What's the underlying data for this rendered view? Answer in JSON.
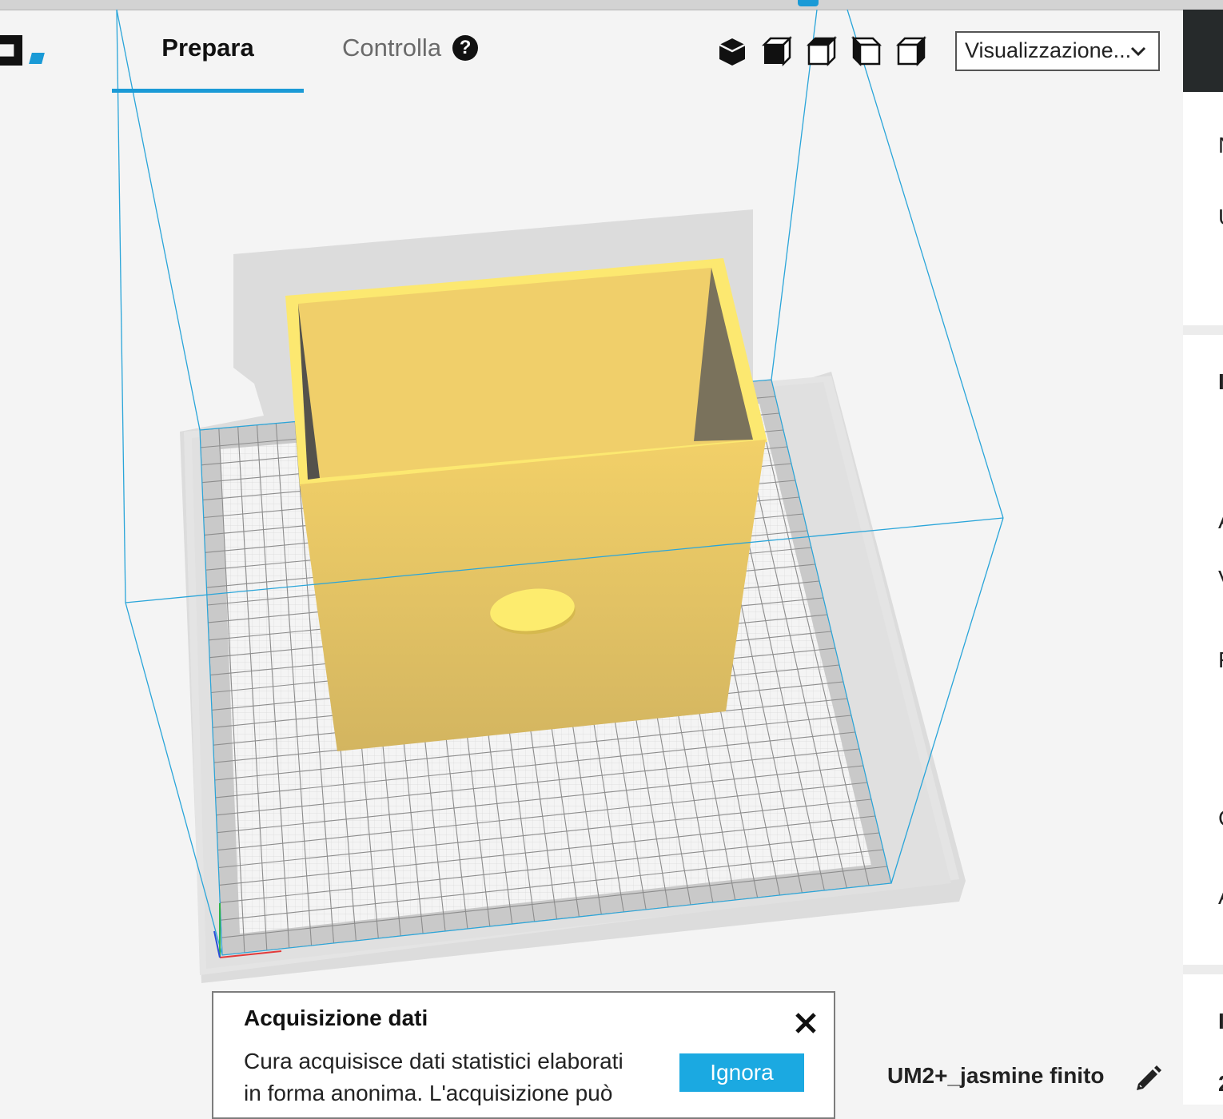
{
  "window": {
    "tabs": [
      {
        "label": "Prepara",
        "active": true
      },
      {
        "label": "Controlla",
        "active": false
      }
    ],
    "help_glyph": "?"
  },
  "view_toolbar": {
    "buttons": [
      "view-3d-icon",
      "view-front-icon",
      "view-top-icon",
      "view-left-icon",
      "view-right-icon"
    ],
    "view_mode_label": "Visualizzazione..."
  },
  "sidebar": {
    "partial_letters": [
      "N",
      "U",
      "I",
      "A",
      "V",
      "F",
      "C",
      "A",
      "I",
      "2"
    ]
  },
  "notification": {
    "title": "Acquisizione dati",
    "line1": "Cura acquisisce dati statistici elaborati",
    "line2": "in forma anonima. L'acquisizione può",
    "dismiss_label": "Ignora",
    "close_icon": "close-icon"
  },
  "job": {
    "name": "UM2+_jasmine finito",
    "edit_icon": "pencil-icon"
  },
  "colors": {
    "accent": "#1a9ad6",
    "button": "#1ba9e1",
    "model": "#f0c85a",
    "build_volume": "#2aa5d9",
    "dark_panel": "#262a2b"
  }
}
